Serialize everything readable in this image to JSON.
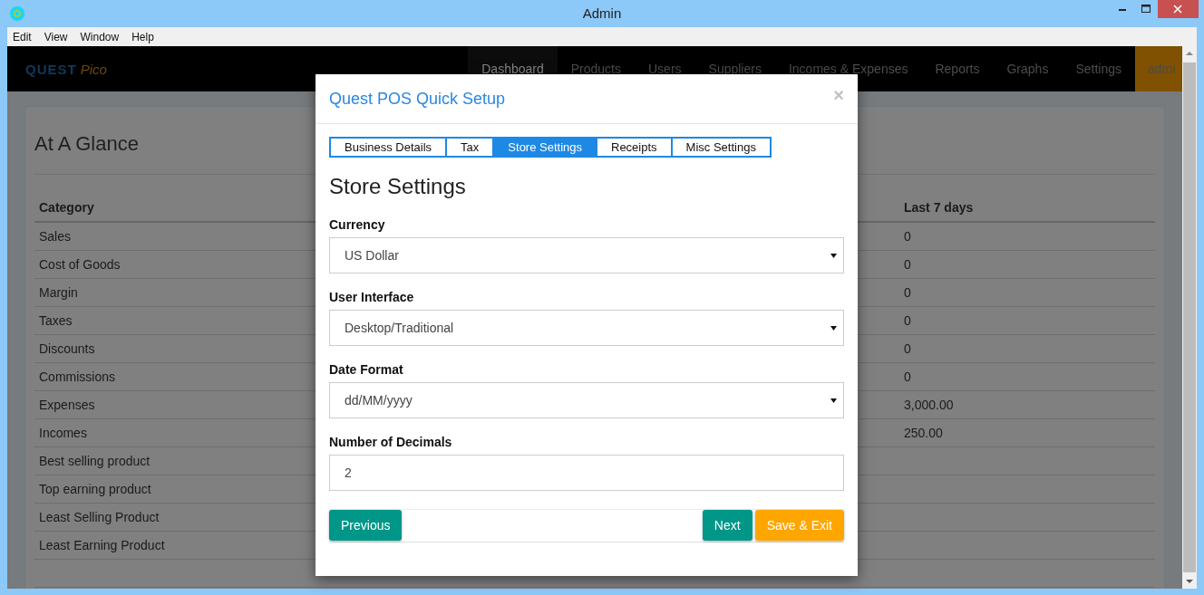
{
  "window": {
    "title": "Admin"
  },
  "menu": [
    "Edit",
    "View",
    "Window",
    "Help"
  ],
  "brand": {
    "part_1": "QUEST",
    "part_2": "Pico"
  },
  "nav": [
    {
      "label": "Dashboard",
      "selected": true,
      "kind": "link"
    },
    {
      "label": "Products",
      "selected": false,
      "kind": "link"
    },
    {
      "label": "Users",
      "selected": false,
      "kind": "link"
    },
    {
      "label": "Suppliers",
      "selected": false,
      "kind": "link"
    },
    {
      "label": "Incomes & Expenses",
      "selected": false,
      "kind": "link"
    },
    {
      "label": "Reports",
      "selected": false,
      "kind": "link"
    },
    {
      "label": "Graphs",
      "selected": false,
      "kind": "link"
    },
    {
      "label": "Settings",
      "selected": false,
      "kind": "link"
    },
    {
      "label": "admi",
      "selected": false,
      "kind": "user"
    }
  ],
  "card": {
    "title": "At A Glance",
    "table": {
      "columns": [
        "Category",
        "Last 7 days"
      ],
      "rows": [
        {
          "category": "Sales",
          "last_7_days": "0"
        },
        {
          "category": "Cost of Goods",
          "last_7_days": "0"
        },
        {
          "category": "Margin",
          "last_7_days": "0"
        },
        {
          "category": "Taxes",
          "last_7_days": "0"
        },
        {
          "category": "Discounts",
          "last_7_days": "0"
        },
        {
          "category": "Commissions",
          "last_7_days": "0"
        },
        {
          "category": "Expenses",
          "last_7_days": "3,000.00"
        },
        {
          "category": "Incomes",
          "last_7_days": "250.00"
        },
        {
          "category": "Best selling product"
        },
        {
          "category": "Top earning product"
        },
        {
          "category": "Least Selling Product"
        },
        {
          "category": "Least Earning Product"
        }
      ]
    }
  },
  "dialog": {
    "title": "Quest POS Quick Setup",
    "close": "×",
    "tabs": [
      {
        "label": "Business Details",
        "selected": false
      },
      {
        "label": "Tax",
        "selected": false
      },
      {
        "label": "Store Settings",
        "selected": true
      },
      {
        "label": "Receipts",
        "selected": false
      },
      {
        "label": "Misc Settings",
        "selected": false
      }
    ],
    "heading": "Store Settings",
    "fields": [
      {
        "label": "Currency",
        "kind": "select",
        "value": "US Dollar"
      },
      {
        "label": "User Interface",
        "kind": "select",
        "value": "Desktop/Traditional"
      },
      {
        "label": "Date Format",
        "kind": "select",
        "value": "dd/MM/yyyy"
      },
      {
        "label": "Number of Decimals",
        "kind": "input",
        "value": "2"
      }
    ],
    "buttons": [
      {
        "label": "Previous",
        "kind": "secondary"
      },
      {
        "label": "Next",
        "kind": "primary"
      },
      {
        "label": "Save & Exit",
        "kind": "accent"
      }
    ]
  }
}
